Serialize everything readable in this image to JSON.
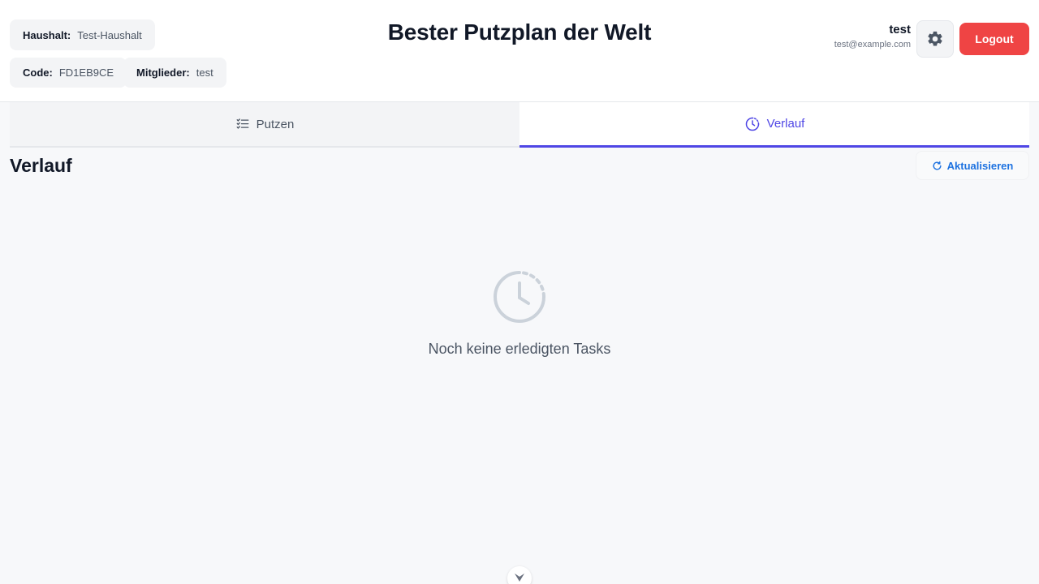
{
  "header": {
    "title": "Bester Putzplan der Welt",
    "household_label": "Haushalt:",
    "household_value": "Test-Haushalt",
    "code_label": "Code:",
    "code_value": "FD1EB9CE",
    "members_label": "Mitglieder:",
    "members_value": "test",
    "user_name": "test",
    "user_email": "test@example.com",
    "settings_icon": "gear-icon",
    "logout_label": "Logout"
  },
  "tabs": [
    {
      "label": "Putzen",
      "icon": "checklist-icon",
      "active": false
    },
    {
      "label": "Verlauf",
      "icon": "history-clock-icon",
      "active": true
    }
  ],
  "main": {
    "section_title": "Verlauf",
    "refresh_label": "Aktualisieren",
    "refresh_icon": "refresh-icon",
    "empty_icon": "history-clock-icon",
    "empty_text": "Noch keine erledigten Tasks"
  },
  "colors": {
    "accent": "#4f46e5",
    "logout": "#ef4444",
    "link": "#1d72e0"
  }
}
